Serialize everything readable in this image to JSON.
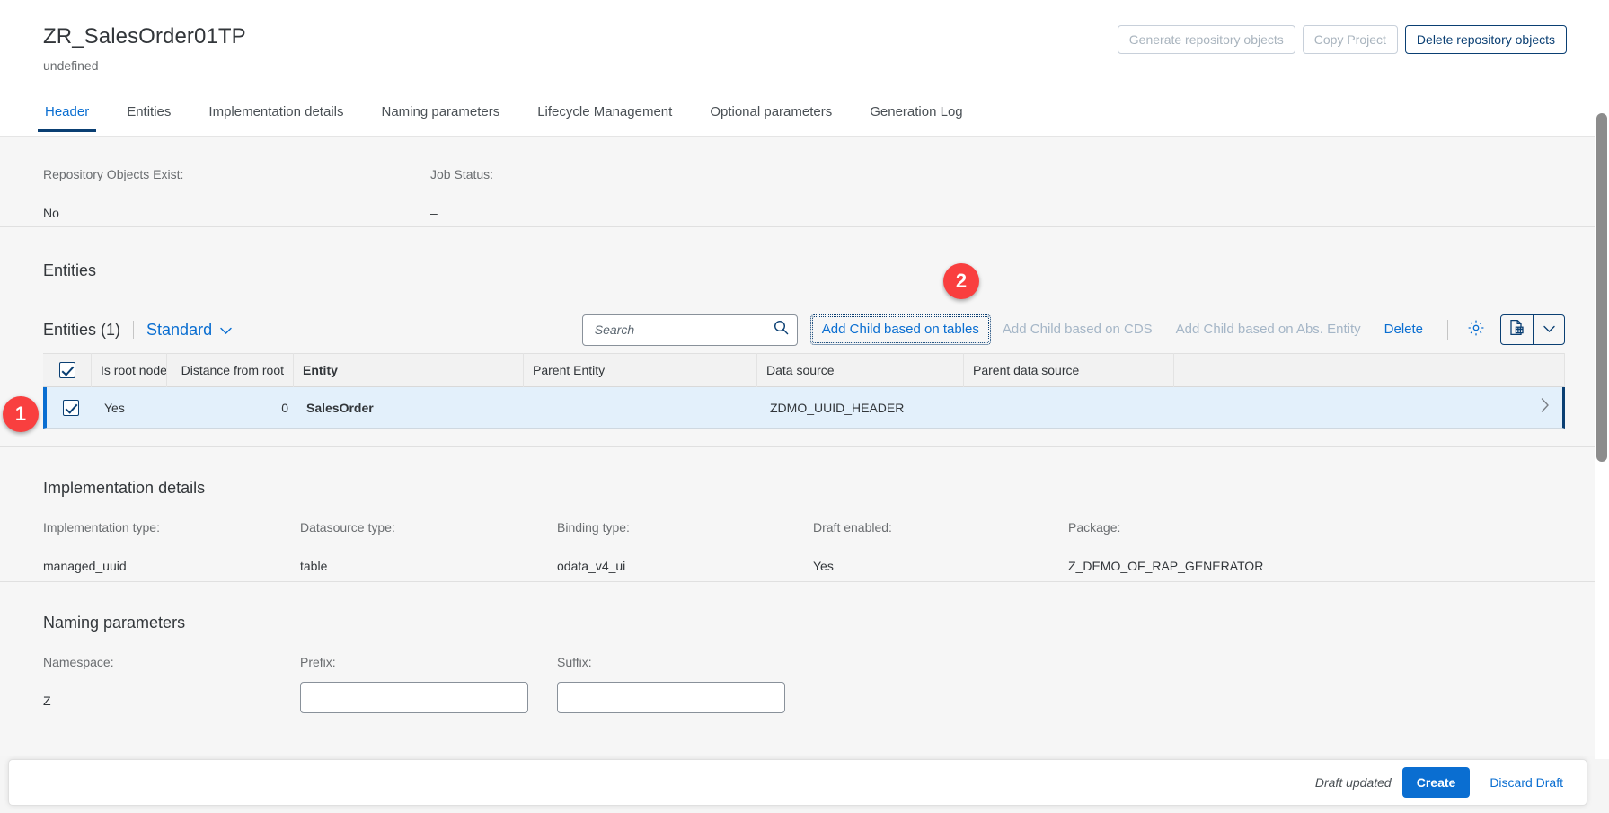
{
  "header": {
    "title": "ZR_SalesOrder01TP",
    "subtitle": "undefined",
    "actions": [
      {
        "label": "Generate repository objects",
        "state": "disabled"
      },
      {
        "label": "Copy Project",
        "state": "disabled"
      },
      {
        "label": "Delete repository objects",
        "state": "enabled"
      }
    ]
  },
  "tabs": [
    {
      "label": "Header",
      "active": true
    },
    {
      "label": "Entities",
      "active": false
    },
    {
      "label": "Implementation details",
      "active": false
    },
    {
      "label": "Naming parameters",
      "active": false
    },
    {
      "label": "Lifecycle Management",
      "active": false
    },
    {
      "label": "Optional parameters",
      "active": false
    },
    {
      "label": "Generation Log",
      "active": false
    }
  ],
  "header_fields": {
    "repo_objects_exist_label": "Repository Objects Exist:",
    "repo_objects_exist_value": "No",
    "job_status_label": "Job Status:",
    "job_status_value": "–"
  },
  "entities": {
    "section_title": "Entities",
    "table_title": "Entities (1)",
    "variant": "Standard",
    "search_placeholder": "Search",
    "toolbar": {
      "add_child_tables": "Add Child based on tables",
      "add_child_cds": "Add Child based on CDS",
      "add_child_abs_entity": "Add Child based on Abs. Entity",
      "delete": "Delete"
    },
    "columns": [
      "Is root node",
      "Distance from root",
      "Entity",
      "Parent Entity",
      "Data source",
      "Parent data source"
    ],
    "rows": [
      {
        "selected": true,
        "is_root_node": "Yes",
        "distance_from_root": "0",
        "entity": "SalesOrder",
        "parent_entity": "",
        "data_source": "ZDMO_UUID_HEADER",
        "parent_data_source": ""
      }
    ]
  },
  "implementation_details": {
    "section_title": "Implementation details",
    "fields": [
      {
        "label": "Implementation type:",
        "value": "managed_uuid"
      },
      {
        "label": "Datasource type:",
        "value": "table"
      },
      {
        "label": "Binding type:",
        "value": "odata_v4_ui"
      },
      {
        "label": "Draft enabled:",
        "value": "Yes"
      },
      {
        "label": "Package:",
        "value": "Z_DEMO_OF_RAP_GENERATOR"
      }
    ]
  },
  "naming_parameters": {
    "section_title": "Naming parameters",
    "namespace_label": "Namespace:",
    "namespace_value": "Z",
    "prefix_label": "Prefix:",
    "prefix_value": "",
    "suffix_label": "Suffix:",
    "suffix_value": ""
  },
  "footer": {
    "draft_status": "Draft updated",
    "create_label": "Create",
    "discard_label": "Discard Draft"
  },
  "step_badges": [
    {
      "number": "1"
    },
    {
      "number": "2"
    }
  ],
  "colors": {
    "accent": "#0a6ed1",
    "accent_dark": "#0a3f73",
    "badge_red": "#f93f3f",
    "row_selected_bg": "#e3f0fb",
    "page_bg": "#f6f6f6"
  }
}
